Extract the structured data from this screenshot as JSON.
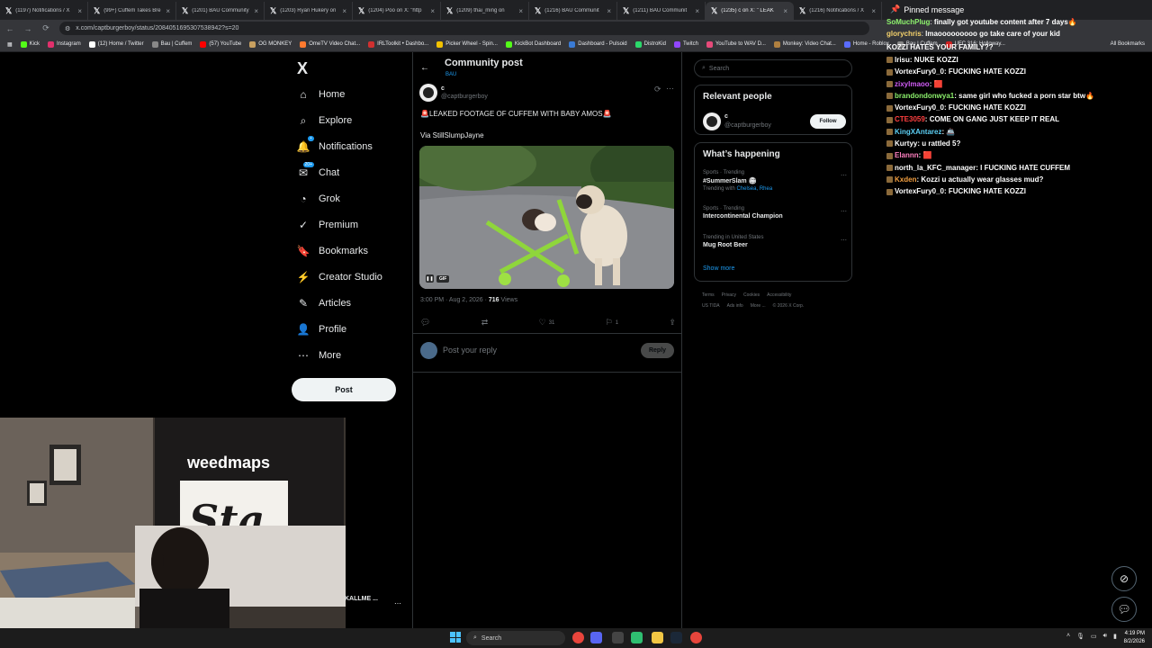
{
  "browser": {
    "tabs": [
      {
        "label": "(1197) Notifications / X",
        "active": false
      },
      {
        "label": "(99+) Cuffem Takes Bre",
        "active": false
      },
      {
        "label": "(1201) BAU Community",
        "active": false
      },
      {
        "label": "(1203) Ryan Hukery on",
        "active": false
      },
      {
        "label": "(1204) Poo on X: \"http",
        "active": false
      },
      {
        "label": "(1209) thai_ming on",
        "active": false
      },
      {
        "label": "(1216) BAU Communit",
        "active": false
      },
      {
        "label": "(1211) BAU Communit",
        "active": false
      },
      {
        "label": "(1235) c on X: \" LEAK",
        "active": true
      },
      {
        "label": "(1216) Notifications / X",
        "active": false
      }
    ],
    "url": "x.com/captburgerboy/status/2084051695307538942?s=20",
    "bookmarks": [
      {
        "label": "Kick",
        "color": "#53fc18"
      },
      {
        "label": "Instagram",
        "color": "#e1306c"
      },
      {
        "label": "(12) Home / Twitter",
        "color": "#ffffff"
      },
      {
        "label": "Bau | Cuffem",
        "color": "#888888"
      },
      {
        "label": "(57) YouTube",
        "color": "#ff0000"
      },
      {
        "label": "OG MONKEY",
        "color": "#c8a060"
      },
      {
        "label": "OmeTV Video Chat...",
        "color": "#ff7a2f"
      },
      {
        "label": "IRLToolkit • Dashbo...",
        "color": "#d03030"
      },
      {
        "label": "Picker Wheel - Spin...",
        "color": "#f2c200"
      },
      {
        "label": "KickBot Dashboard",
        "color": "#53fc18"
      },
      {
        "label": "Dashboard - Pulsoid",
        "color": "#3a7bd5"
      },
      {
        "label": "DistroKid",
        "color": "#2bd96b"
      },
      {
        "label": "Twitch",
        "color": "#9146ff"
      },
      {
        "label": "YouTube to WAV D...",
        "color": "#e64a7a"
      },
      {
        "label": "Monkey: Video Chat...",
        "color": "#b08040"
      },
      {
        "label": "Home - Roblox",
        "color": "#5a6cff"
      },
      {
        "label": "Bau | Cuffem",
        "color": "#888888"
      },
      {
        "label": "UFC 316: Holloway...",
        "color": "#d02020"
      }
    ],
    "all_bookmarks": "All Bookmarks"
  },
  "nav": {
    "logo": "X",
    "items": [
      {
        "label": "Home",
        "icon": "⌂",
        "badge": ""
      },
      {
        "label": "Explore",
        "icon": "⌕",
        "badge": ""
      },
      {
        "label": "Notifications",
        "icon": "🔔",
        "badge": "•"
      },
      {
        "label": "Chat",
        "icon": "✉",
        "badge": "20+"
      },
      {
        "label": "Grok",
        "icon": "◔",
        "badge": ""
      },
      {
        "label": "Premium",
        "icon": "✓",
        "badge": ""
      },
      {
        "label": "Bookmarks",
        "icon": "🔖",
        "badge": ""
      },
      {
        "label": "Creator Studio",
        "icon": "⚡",
        "badge": ""
      },
      {
        "label": "Articles",
        "icon": "✎",
        "badge": ""
      },
      {
        "label": "Profile",
        "icon": "👤",
        "badge": ""
      },
      {
        "label": "More",
        "icon": "⋯",
        "badge": ""
      }
    ],
    "post_label": "Post"
  },
  "post": {
    "header_title": "Community post",
    "header_sub": "BAU",
    "author_name": "c",
    "author_handle": "@captburgerboy",
    "text": "🚨LEAKED FOOTAGE OF CUFFEM WITH BABY AMOS🚨",
    "via": "Via StillSlumpJayne",
    "gif_label": "GIF",
    "timestamp": "3:00 PM · Aug 2, 2026 · ",
    "views_count": "716",
    "views_label": " Views",
    "likes": "31",
    "bookmarks": "1",
    "reply_placeholder": "Post your reply",
    "reply_button": "Reply"
  },
  "sidebar": {
    "search_placeholder": "Search",
    "relevant_title": "Relevant people",
    "person_name": "c",
    "person_handle": "@captburgerboy",
    "follow_label": "Follow",
    "happening_title": "What’s happening",
    "trends": [
      {
        "category": "Sports · Trending",
        "name": "#SummerSlam 🏟",
        "extra_prefix": "Trending with ",
        "extra_links": "Chelsea, Rhea"
      },
      {
        "category": "Sports · Trending",
        "name": "Intercontinental Champion",
        "extra_prefix": "",
        "extra_links": ""
      },
      {
        "category": "Trending in United States",
        "name": "Mug Root Beer",
        "extra_prefix": "",
        "extra_links": ""
      }
    ],
    "show_more": "Show more",
    "footer_links": [
      "Terms",
      "Privacy",
      "Cookies",
      "Accessibility",
      "US TIDA",
      "Ads info",
      "More ...",
      "© 2026 X Corp."
    ]
  },
  "chat": {
    "pinned_title": "Pinned message",
    "pinned_lines": [
      {
        "user": "SoMuchPlug",
        "user_color": "#8cf06c",
        "msg": "finally got youtube content after 7 days🔥"
      },
      {
        "user": "glorychris",
        "user_color": "#f5d26c",
        "msg": "lmaooooooooo go take care of your kid"
      },
      {
        "user": "",
        "user_color": "#ffffff",
        "msg": "KOZZI HATES YOUR FAMILY??"
      }
    ],
    "lines": [
      {
        "user": "lrisu",
        "user_color": "#ffffff",
        "msg": "NUKE KOZZI"
      },
      {
        "user": "VortexFury0_0",
        "user_color": "#ffffff",
        "msg": "FUCKING HATE KOZZI"
      },
      {
        "user": "zixylmaoo",
        "user_color": "#d05cf5",
        "msg": "🟥"
      },
      {
        "user": "brandondonwya1",
        "user_color": "#8cf06c",
        "msg": "same girl who fucked a porn star btw🔥"
      },
      {
        "user": "VortexFury0_0",
        "user_color": "#ffffff",
        "msg": "FUCKING HATE KOZZI"
      },
      {
        "user": "CTE3059",
        "user_color": "#ff4040",
        "msg": "COME ON GANG JUST KEEP IT REAL"
      },
      {
        "user": "KingXAntarez",
        "user_color": "#5cd0f5",
        "msg": "🚢"
      },
      {
        "user": "Kurtyy",
        "user_color": "#ffffff",
        "msg": "u rattled 5?"
      },
      {
        "user": "Elannn",
        "user_color": "#ff80c0",
        "msg": "🟥"
      },
      {
        "user": "north_la_KFC_manager",
        "user_color": "#ffffff",
        "msg": "I FUCKING HATE CUFFEM"
      },
      {
        "user": "Kxden",
        "user_color": "#f5a040",
        "msg": "Kozzi u actually wear glasses mud?"
      },
      {
        "user": "VortexFury0_0",
        "user_color": "#ffffff",
        "msg": "FUCKING HATE KOZZI"
      }
    ]
  },
  "webcam": {
    "banner_text": "weedmaps",
    "sign_text": "Sta",
    "caption_name": "KALLME ...",
    "caption_sub": "n"
  },
  "taskbar": {
    "search_label": "Search",
    "time": "4:19 PM",
    "date": "8/2/2026"
  }
}
